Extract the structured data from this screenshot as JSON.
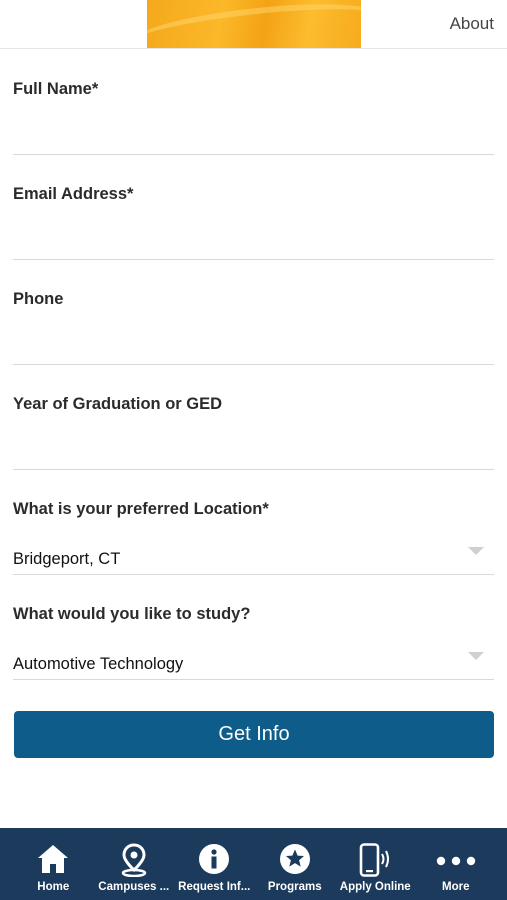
{
  "header": {
    "about_label": "About"
  },
  "form": {
    "fields": [
      {
        "label": "Full Name*",
        "value": ""
      },
      {
        "label": "Email Address*",
        "value": ""
      },
      {
        "label": "Phone",
        "value": ""
      },
      {
        "label": "Year of Graduation or GED",
        "value": ""
      },
      {
        "label": "What is your preferred Location*",
        "value": "Bridgeport, CT"
      },
      {
        "label": "What would you like to study?",
        "value": "Automotive Technology"
      }
    ],
    "submit_label": "Get Info"
  },
  "tabbar": {
    "items": [
      {
        "label": "Home",
        "icon": "home-icon"
      },
      {
        "label": "Campuses ...",
        "icon": "location-pin-icon"
      },
      {
        "label": "Request Inf...",
        "icon": "info-icon"
      },
      {
        "label": "Programs",
        "icon": "star-icon"
      },
      {
        "label": "Apply Online",
        "icon": "mobile-phone-icon"
      },
      {
        "label": "More",
        "icon": "more-dots-icon"
      }
    ]
  },
  "colors": {
    "accent": "#0d5c8a",
    "tabbar": "#1b3a5c",
    "banner": "#f5a81c"
  }
}
